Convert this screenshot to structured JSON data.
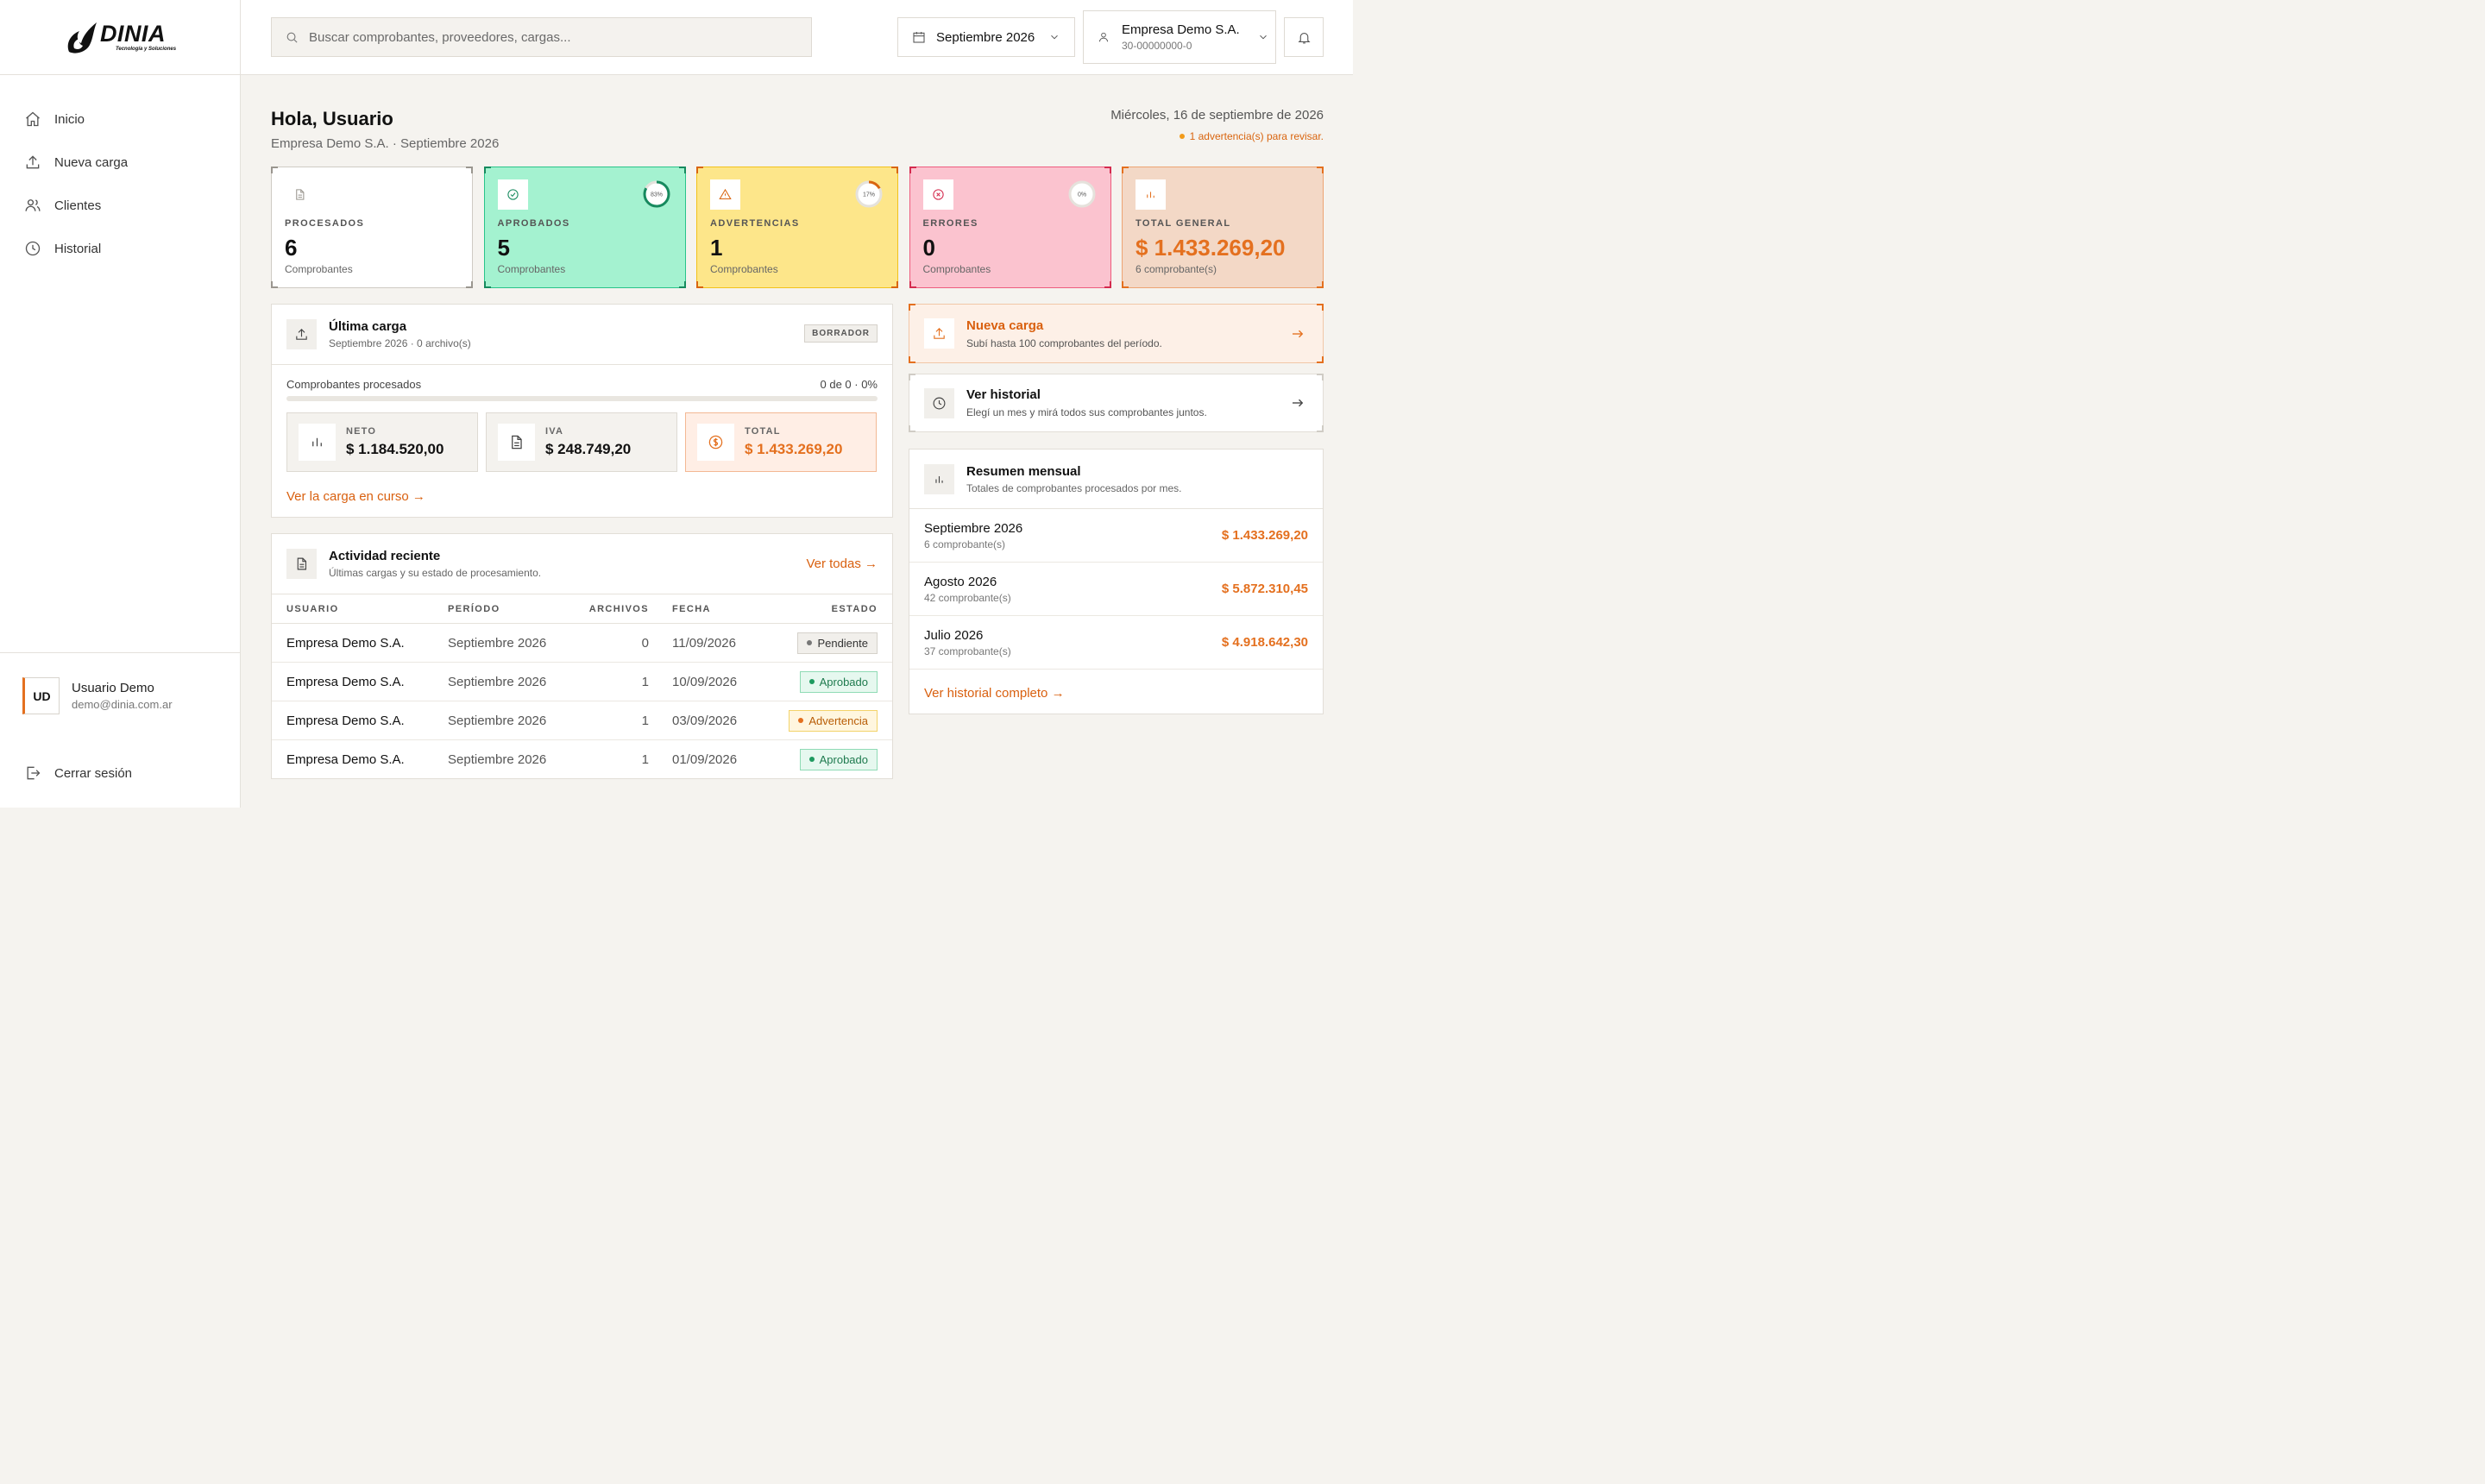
{
  "brand": {
    "name": "DINIA",
    "tagline": "Tecnología y Soluciones"
  },
  "sidebar": {
    "items": [
      {
        "label": "Inicio",
        "icon": "home-icon"
      },
      {
        "label": "Nueva carga",
        "icon": "upload-icon"
      },
      {
        "label": "Clientes",
        "icon": "users-icon"
      },
      {
        "label": "Historial",
        "icon": "clock-icon"
      }
    ],
    "user": {
      "initials": "UD",
      "name": "Usuario Demo",
      "email": "demo@dinia.com.ar"
    },
    "logout_label": "Cerrar sesión"
  },
  "topbar": {
    "search_placeholder": "Buscar comprobantes, proveedores, cargas...",
    "period": "Septiembre 2026",
    "company": {
      "name": "Empresa Demo S.A.",
      "cuit": "30-00000000-0"
    }
  },
  "header": {
    "greeting": "Hola, Usuario",
    "subtitle": "Empresa Demo S.A. · Septiembre 2026",
    "date": "Miércoles, 16 de septiembre de 2026",
    "warning": "1 advertencia(s) para revisar."
  },
  "stats": [
    {
      "label": "PROCESADOS",
      "value": "6",
      "sub": "Comprobantes",
      "icon": "document-icon",
      "bg": "#ffffff",
      "border": "#cfcbc4",
      "accent": "#9a968f"
    },
    {
      "label": "APROBADOS",
      "value": "5",
      "sub": "Comprobantes",
      "icon": "check-circle-icon",
      "bg": "#a4f2d0",
      "border": "#29c48a",
      "accent": "#168a5e",
      "ring_label": "83%",
      "ring_pct": 83
    },
    {
      "label": "ADVERTENCIAS",
      "value": "1",
      "sub": "Comprobantes",
      "icon": "warning-icon",
      "bg": "#fde68a",
      "border": "#f2c21b",
      "accent": "#d9650f",
      "ring_label": "17%",
      "ring_pct": 17
    },
    {
      "label": "ERRORES",
      "value": "0",
      "sub": "Comprobantes",
      "icon": "x-circle-icon",
      "bg": "#fbc3cf",
      "border": "#ee5c7e",
      "accent": "#d42b4e",
      "ring_label": "0%",
      "ring_pct": 0
    },
    {
      "label": "TOTAL GENERAL",
      "value": "$ 1.433.269,20",
      "sub": "6 comprobante(s)",
      "icon": "bar-chart-icon",
      "bg": "#f3d8c6",
      "border": "#eda473",
      "accent": "#e4701f"
    }
  ],
  "last_upload": {
    "title": "Última carga",
    "subtitle": "Septiembre 2026 · 0 archivo(s)",
    "badge": "BORRADOR",
    "progress_label": "Comprobantes procesados",
    "progress_value": "0 de 0 · 0%",
    "progress_pct": 0,
    "neto_label": "NETO",
    "neto": "$ 1.184.520,00",
    "iva_label": "IVA",
    "iva": "$ 248.749,20",
    "total_label": "TOTAL",
    "total": "$ 1.433.269,20",
    "link": "Ver la carga en curso →"
  },
  "activity": {
    "title": "Actividad reciente",
    "subtitle": "Últimas cargas y su estado de procesamiento.",
    "link": "Ver todas →",
    "columns": [
      "USUARIO",
      "PERÍODO",
      "ARCHIVOS",
      "FECHA",
      "ESTADO"
    ],
    "rows": [
      {
        "user": "Empresa Demo S.A.",
        "period": "Septiembre 2026",
        "files": "0",
        "date": "11/09/2026",
        "status": "Pendiente",
        "kind": "p"
      },
      {
        "user": "Empresa Demo S.A.",
        "period": "Septiembre 2026",
        "files": "1",
        "date": "10/09/2026",
        "status": "Aprobado",
        "kind": "a"
      },
      {
        "user": "Empresa Demo S.A.",
        "period": "Septiembre 2026",
        "files": "1",
        "date": "03/09/2026",
        "status": "Advertencia",
        "kind": "w"
      },
      {
        "user": "Empresa Demo S.A.",
        "period": "Septiembre 2026",
        "files": "1",
        "date": "01/09/2026",
        "status": "Aprobado",
        "kind": "a"
      }
    ]
  },
  "new_upload": {
    "title": "Nueva carga",
    "subtitle": "Subí hasta 100 comprobantes del período."
  },
  "history": {
    "title": "Ver historial",
    "subtitle": "Elegí un mes y mirá todos sus comprobantes juntos."
  },
  "monthly": {
    "title": "Resumen mensual",
    "subtitle": "Totales de comprobantes procesados por mes.",
    "rows": [
      {
        "month": "Septiembre 2026",
        "count": "6 comprobante(s)",
        "total": "$ 1.433.269,20"
      },
      {
        "month": "Agosto 2026",
        "count": "42 comprobante(s)",
        "total": "$ 5.872.310,45"
      },
      {
        "month": "Julio 2026",
        "count": "37 comprobante(s)",
        "total": "$ 4.918.642,30"
      }
    ],
    "link": "Ver historial completo →"
  },
  "colors": {
    "accent": "#e4701f",
    "bg": "#f5f3ef"
  }
}
